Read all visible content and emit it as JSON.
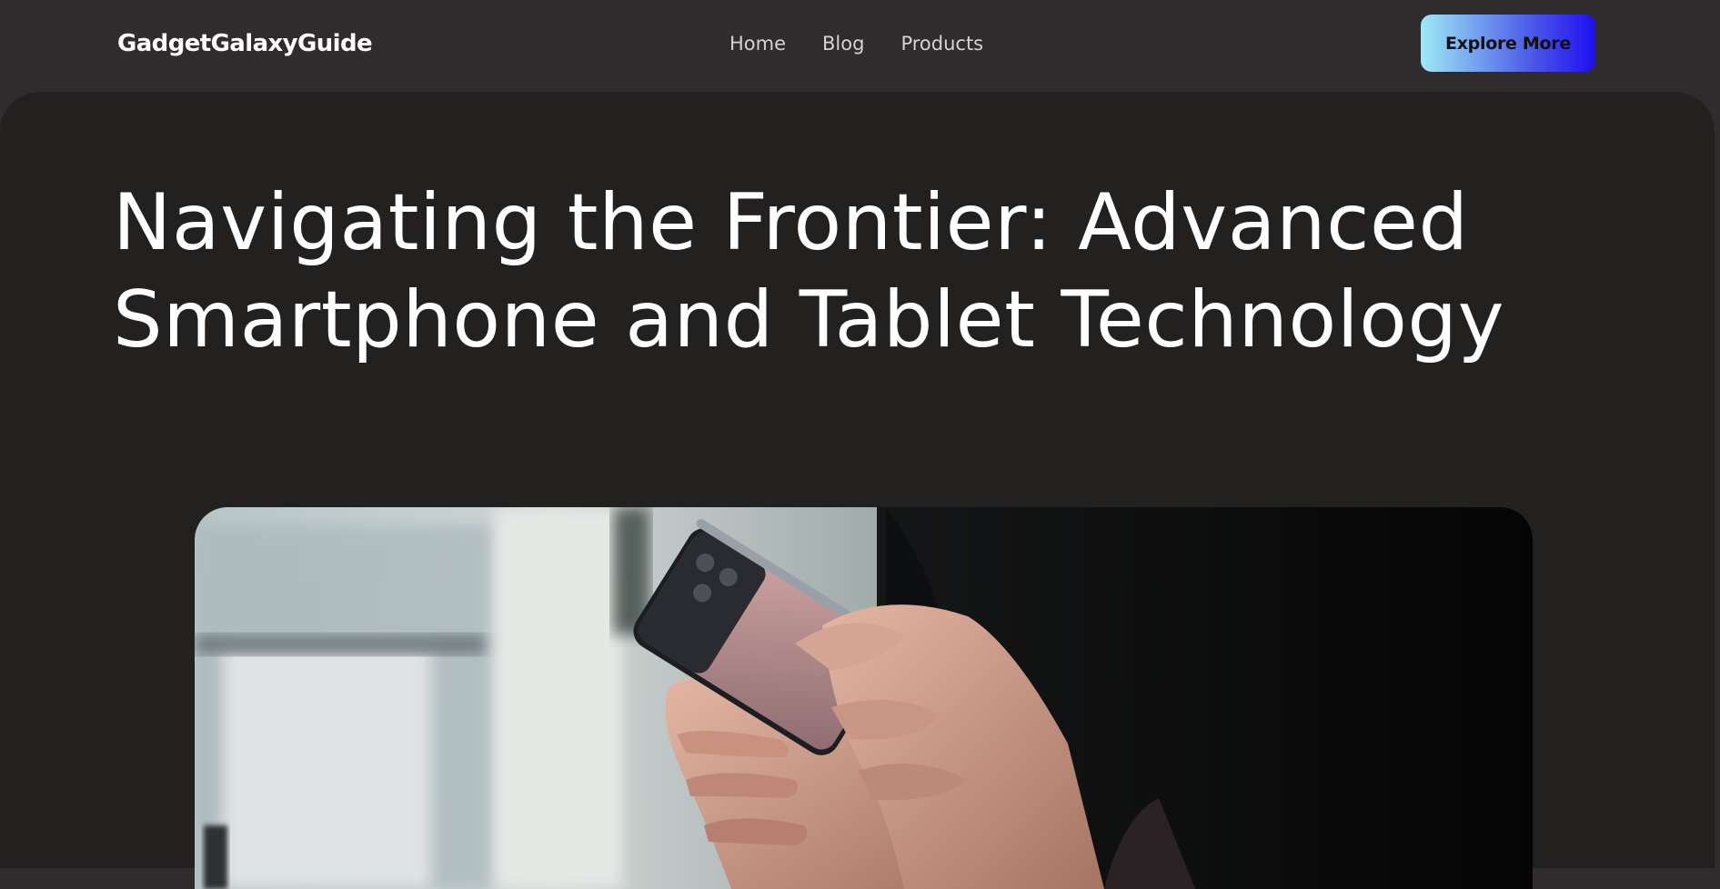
{
  "header": {
    "brand": "GadgetGalaxyGuide",
    "nav": [
      "Home",
      "Blog",
      "Products"
    ],
    "cta_label": "Explore More"
  },
  "hero": {
    "title": "Navigating the Frontier: Advanced Smartphone and Tablet Technology"
  },
  "colors": {
    "header_bg": "#302b2c",
    "hero_bg": "#232120",
    "text": "#ffffff",
    "nav_text": "#d6d3d4",
    "cta_gradient_start": "#9ee9f6",
    "cta_gradient_end": "#1d0ef3"
  }
}
